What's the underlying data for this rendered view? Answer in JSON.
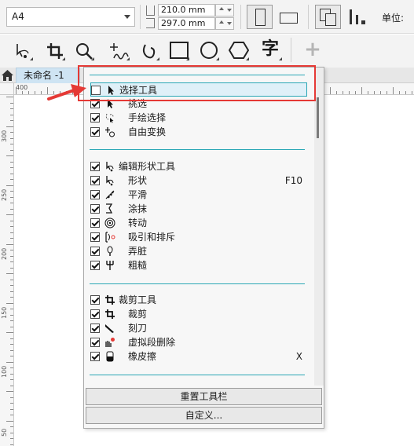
{
  "property_bar": {
    "page_size": "A4",
    "width_value": "210.0 mm",
    "height_value": "297.0 mm",
    "units_label": "单位:"
  },
  "toolbar": {
    "tools": [
      "pick-tool",
      "crop-tool",
      "zoom-tool",
      "freehand-tool",
      "artistic-media-tool",
      "rectangle-tool",
      "ellipse-tool",
      "polygon-tool",
      "text-tool"
    ],
    "text_tool_glyph": "字",
    "add_button": "+"
  },
  "document": {
    "tab_label": "未命名 -1"
  },
  "rulers": {
    "horizontal": [
      "400"
    ],
    "vertical": [
      "300",
      "250",
      "200",
      "150",
      "100",
      "50"
    ]
  },
  "menu": {
    "groups": [
      {
        "items": [
          {
            "label": "选择工具",
            "checked": false,
            "icon": "pointer-icon",
            "parent": true
          },
          {
            "label": "挑选",
            "checked": true,
            "icon": "pick-icon"
          },
          {
            "label": "手绘选择",
            "checked": true,
            "icon": "freehand-pick-icon"
          },
          {
            "label": "自由变换",
            "checked": true,
            "icon": "free-transform-icon"
          }
        ]
      },
      {
        "items": [
          {
            "label": "编辑形状工具",
            "checked": true,
            "icon": "shape-edit-icon",
            "parent": true
          },
          {
            "label": "形状",
            "checked": true,
            "icon": "shape-icon",
            "shortcut": "F10"
          },
          {
            "label": "平滑",
            "checked": true,
            "icon": "smooth-icon"
          },
          {
            "label": "涂抹",
            "checked": true,
            "icon": "smear-icon"
          },
          {
            "label": "转动",
            "checked": true,
            "icon": "twirl-icon"
          },
          {
            "label": "吸引和排斥",
            "checked": true,
            "icon": "attract-repel-icon"
          },
          {
            "label": "弄脏",
            "checked": true,
            "icon": "smudge-icon"
          },
          {
            "label": "粗糙",
            "checked": true,
            "icon": "roughen-icon"
          }
        ]
      },
      {
        "items": [
          {
            "label": "裁剪工具",
            "checked": true,
            "icon": "crop-tool-icon",
            "parent": true
          },
          {
            "label": "裁剪",
            "checked": true,
            "icon": "crop-icon"
          },
          {
            "label": "刻刀",
            "checked": true,
            "icon": "knife-icon"
          },
          {
            "label": "虚拟段删除",
            "checked": true,
            "icon": "virtual-segment-delete-icon"
          },
          {
            "label": "橡皮擦",
            "checked": true,
            "icon": "eraser-icon",
            "shortcut": "X"
          }
        ]
      }
    ],
    "reset_button": "重置工具栏",
    "customize_button": "自定义..."
  },
  "colors": {
    "accent_teal": "#2aa7b5",
    "highlight_red": "#e53935",
    "tab_blue": "#cfe4f3"
  }
}
